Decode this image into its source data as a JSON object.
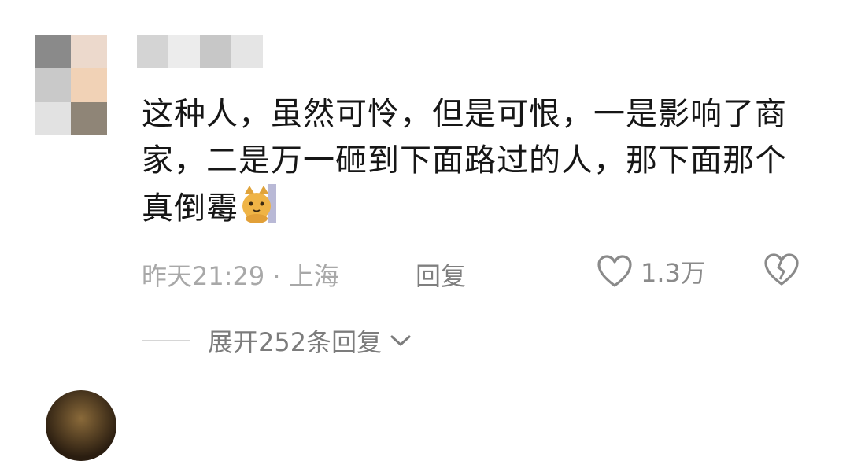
{
  "comment": {
    "text": "这种人，虽然可怜，但是可恨，一是影响了商家，二是万一砸到下面路过的人，那下面那个真倒霉",
    "emoji": "cat-face-sticker-icon",
    "timestamp": "昨天21:29 · 上海",
    "reply_label": "回复",
    "like_count": "1.3万"
  },
  "replies": {
    "expand_label": "展开252条回复"
  },
  "colors": {
    "text": "#161616",
    "meta": "#a8a8a8",
    "reply": "#7f7f7f"
  }
}
